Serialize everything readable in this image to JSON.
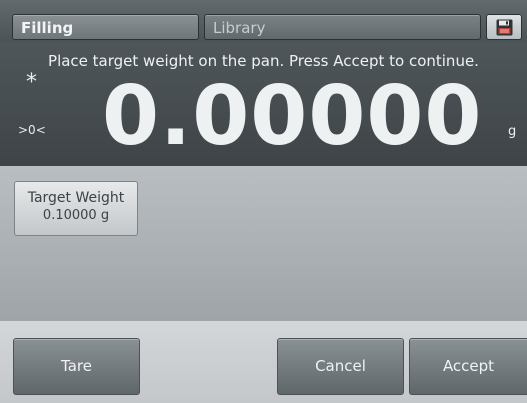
{
  "header": {
    "mode_tab": "Filling",
    "library_tab": "Library",
    "save_icon": "save-icon"
  },
  "display": {
    "instruction": "Place target weight on the pan.  Press Accept to continue.",
    "stability_indicator": "*",
    "zero_indicator": ">0<",
    "reading": "0.00000",
    "unit": "g"
  },
  "target": {
    "label": "Target Weight",
    "value": "0.10000 g"
  },
  "actions": {
    "tare": "Tare",
    "cancel": "Cancel",
    "accept": "Accept"
  },
  "colors": {
    "display_background": "#474e51",
    "button": "#737b7f",
    "accent_red": "#c0392b"
  }
}
